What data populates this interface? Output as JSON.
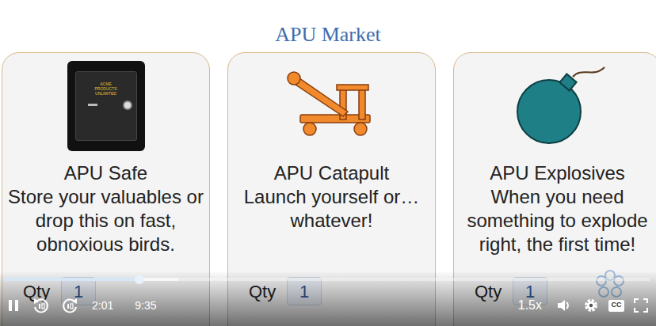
{
  "slide": {
    "title": "APU Market",
    "products": [
      {
        "kind": "safe",
        "badge": "ACME PRODUCTS UNLIMITED",
        "name": "APU Safe",
        "description": [
          "Store your valuables or",
          "drop this on fast,",
          "obnoxious birds."
        ],
        "qty_label": "Qty",
        "qty": "1"
      },
      {
        "kind": "catapult",
        "name": "APU Catapult",
        "description": [
          "Launch yourself or…",
          "whatever!"
        ],
        "qty_label": "Qty",
        "qty": "1"
      },
      {
        "kind": "bomb",
        "name": "APU Explosives",
        "description": [
          "When you need",
          "something to explode",
          "right, the first time!"
        ],
        "qty_label": "Qty",
        "qty": "1"
      }
    ]
  },
  "player": {
    "playing": true,
    "played": 0.21,
    "buffered": 0.27,
    "current_time": "2:01",
    "duration": "9:35",
    "speed": "1.5x",
    "muted": false,
    "captions_label": "CC"
  }
}
